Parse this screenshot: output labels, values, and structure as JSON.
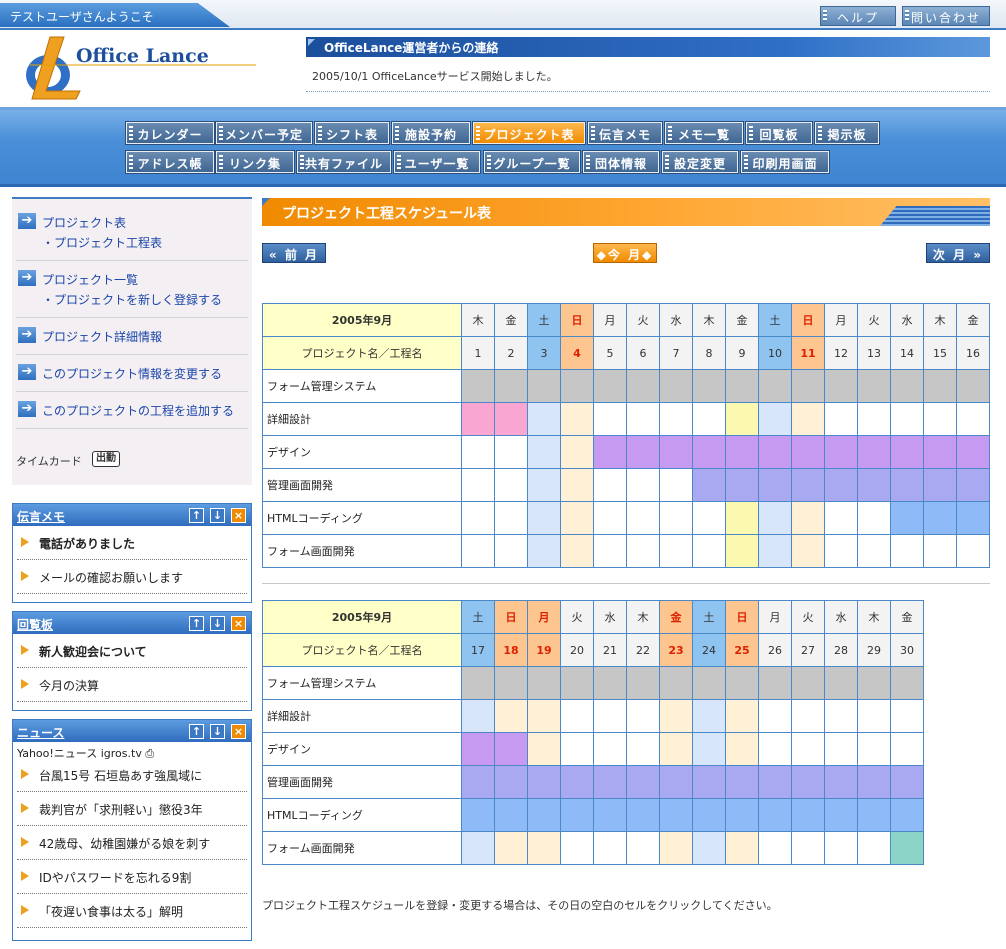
{
  "topbar": {
    "welcome": "テストユーザさんようこそ",
    "help": "ヘルプ",
    "contact": "問い合わせ"
  },
  "logo": {
    "text": "Office Lance"
  },
  "notice": {
    "title": "OfficeLance運営者からの連絡",
    "message": "2005/10/1 OfficeLanceサービス開始しました。"
  },
  "nav": {
    "row1": [
      "カレンダー",
      "メンバー予定",
      "シフト表",
      "施設予約",
      "プロジェクト表",
      "伝言メモ",
      "メモ一覧",
      "回覧板",
      "掲示板"
    ],
    "row2": [
      "アドレス帳",
      "リンク集",
      "共有ファイル",
      "ユーザ一覧",
      "グループ一覧",
      "団体情報",
      "設定変更",
      "印刷用画面"
    ]
  },
  "leftmenu": {
    "items": [
      {
        "label": "プロジェクト表",
        "sub": "・プロジェクト工程表"
      },
      {
        "label": "プロジェクト一覧",
        "sub": "・プロジェクトを新しく登録する"
      },
      {
        "label": "プロジェクト詳細情報",
        "sub": ""
      },
      {
        "label": "このプロジェクト情報を変更する",
        "sub": ""
      },
      {
        "label": "このプロジェクトの工程を追加する",
        "sub": ""
      }
    ],
    "timecard": "タイムカード",
    "clockin": "出勤"
  },
  "memo": {
    "title": "伝言メモ",
    "items": [
      "電話がありました",
      "メールの確認お願いします"
    ]
  },
  "circular": {
    "title": "回覧板",
    "items": [
      "新人歓迎会について",
      "今月の決算"
    ]
  },
  "news": {
    "title": "ニュース",
    "source": "Yahoo!ニュース igros.tv ⎙",
    "items": [
      "台風15号 石垣島あす強風域に",
      "裁判官が「求刑軽い」懲役3年",
      "42歳母、幼稚園嫌がる娘を刺す",
      "IDやパスワードを忘れる9割",
      "「夜遅い食事は太る」解明"
    ]
  },
  "buttons": {
    "up": "↑",
    "down": "↓",
    "close": "×"
  },
  "main": {
    "title": "プロジェクト工程スケジュール表",
    "prev": "前 月",
    "today": "今 月",
    "next": "次 月",
    "footnote": "プロジェクト工程スケジュールを登録・変更する場合は、その日の空白のセルをクリックしてください。"
  },
  "schedule": {
    "month_label": "2005年9月",
    "name_header": "プロジェクト名／工程名",
    "tasks": [
      "フォーム管理システム",
      "詳細設計",
      "デザイン",
      "管理画面開発",
      "HTMLコーディング",
      "フォーム画面開発"
    ],
    "blocks": [
      {
        "weekdays": [
          "木",
          "金",
          "土",
          "日",
          "月",
          "火",
          "水",
          "木",
          "金",
          "土",
          "日",
          "月",
          "火",
          "水",
          "木",
          "金"
        ],
        "days": [
          "1",
          "2",
          "3",
          "4",
          "5",
          "6",
          "7",
          "8",
          "9",
          "10",
          "11",
          "12",
          "13",
          "14",
          "15",
          "16"
        ],
        "types": [
          "n",
          "n",
          "s",
          "u",
          "n",
          "n",
          "n",
          "n",
          "n",
          "s",
          "u",
          "n",
          "n",
          "n",
          "n",
          "n"
        ],
        "rows": [
          [
            "F",
            "F",
            "F",
            "F",
            "F",
            "F",
            "F",
            "F",
            "F",
            "F",
            "F",
            "F",
            "F",
            "F",
            "F",
            "F"
          ],
          [
            "P",
            "P",
            "s",
            "h",
            "n",
            "n",
            "n",
            "n",
            "Y",
            "s",
            "h",
            "n",
            "n",
            "n",
            "n",
            "n"
          ],
          [
            "n",
            "n",
            "s",
            "h",
            "D",
            "D",
            "D",
            "D",
            "D",
            "D",
            "D",
            "D",
            "D",
            "D",
            "D",
            "D"
          ],
          [
            "n",
            "n",
            "s",
            "h",
            "n",
            "n",
            "n",
            "K",
            "K",
            "K",
            "K",
            "K",
            "K",
            "K",
            "K",
            "K"
          ],
          [
            "n",
            "n",
            "s",
            "h",
            "n",
            "n",
            "n",
            "n",
            "Y",
            "s",
            "h",
            "n",
            "n",
            "H",
            "H",
            "H"
          ],
          [
            "n",
            "n",
            "s",
            "h",
            "n",
            "n",
            "n",
            "n",
            "Y",
            "s",
            "h",
            "n",
            "n",
            "n",
            "n",
            "n"
          ]
        ]
      },
      {
        "weekdays": [
          "土",
          "日",
          "月",
          "火",
          "水",
          "木",
          "金",
          "土",
          "日",
          "月",
          "火",
          "水",
          "木",
          "金"
        ],
        "days": [
          "17",
          "18",
          "19",
          "20",
          "21",
          "22",
          "23",
          "24",
          "25",
          "26",
          "27",
          "28",
          "29",
          "30"
        ],
        "types": [
          "s",
          "u",
          "h",
          "n",
          "n",
          "n",
          "h",
          "s",
          "u",
          "n",
          "n",
          "n",
          "n",
          "n"
        ],
        "rows": [
          [
            "F",
            "F",
            "F",
            "F",
            "F",
            "F",
            "F",
            "F",
            "F",
            "F",
            "F",
            "F",
            "F",
            "F"
          ],
          [
            "s",
            "h",
            "h",
            "n",
            "n",
            "n",
            "h",
            "s",
            "h",
            "n",
            "n",
            "n",
            "n",
            "n"
          ],
          [
            "D",
            "D",
            "h",
            "n",
            "n",
            "n",
            "h",
            "s",
            "h",
            "n",
            "n",
            "n",
            "n",
            "n"
          ],
          [
            "K",
            "K",
            "K",
            "K",
            "K",
            "K",
            "K",
            "K",
            "K",
            "K",
            "K",
            "K",
            "K",
            "K"
          ],
          [
            "H",
            "H",
            "H",
            "H",
            "H",
            "H",
            "H",
            "H",
            "H",
            "H",
            "H",
            "H",
            "H",
            "H"
          ],
          [
            "s",
            "h",
            "h",
            "n",
            "n",
            "n",
            "h",
            "s",
            "h",
            "n",
            "n",
            "n",
            "n",
            "T"
          ]
        ]
      }
    ]
  }
}
